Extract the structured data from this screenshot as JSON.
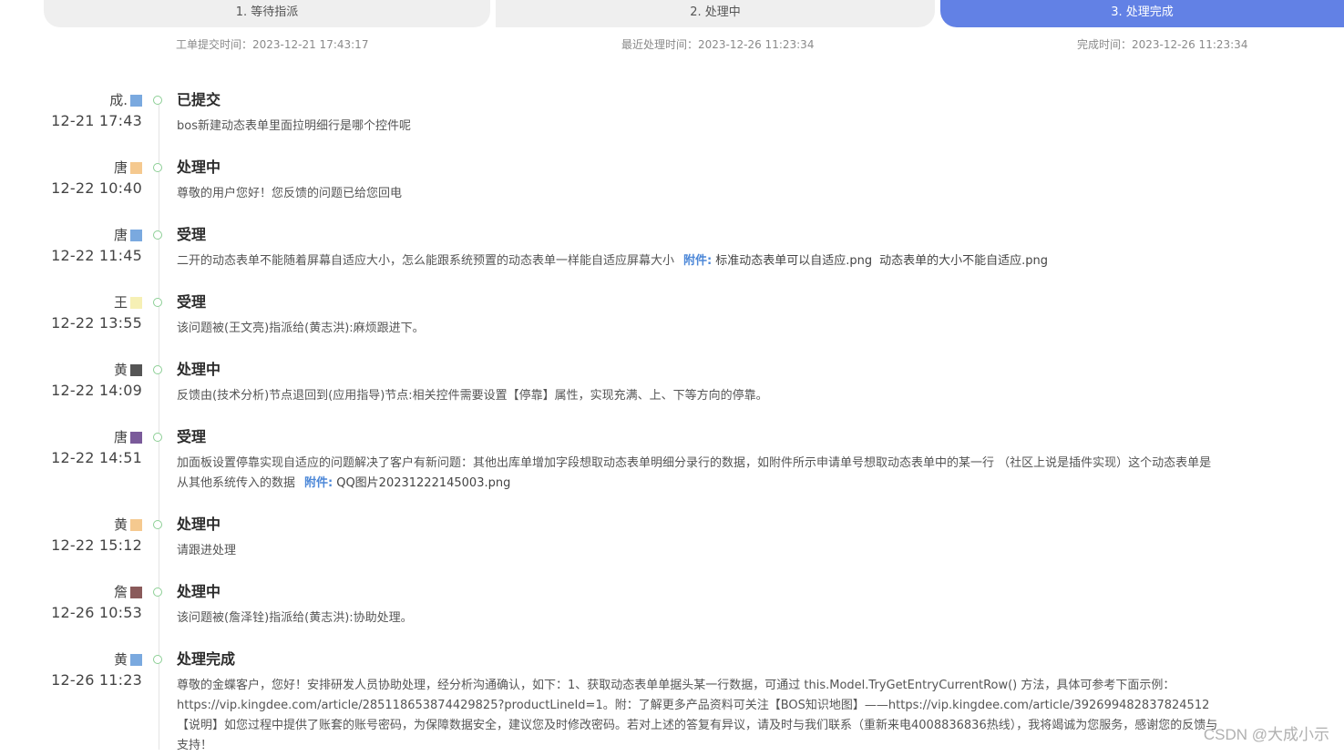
{
  "steps": [
    {
      "label": "1. 等待指派"
    },
    {
      "label": "2. 处理中"
    },
    {
      "label": "3. 处理完成"
    }
  ],
  "step_times": {
    "submitted": "工单提交时间：2023-12-21 17:43:17",
    "recent": "最近处理时间：2023-12-26 11:23:34",
    "done": "完成时间：2023-12-26 11:23:34"
  },
  "entries": [
    {
      "who": "成.",
      "time": "12-21 17:43",
      "status": "已提交",
      "content": "bos新建动态表单里面拉明细行是哪个控件呢",
      "avatar": "#7aa9df"
    },
    {
      "who": "唐",
      "time": "12-22 10:40",
      "status": "处理中",
      "content": "尊敬的用户您好！您反馈的问题已给您回电",
      "avatar": "#f5c98f"
    },
    {
      "who": "唐",
      "time": "12-22 11:45",
      "status": "受理",
      "content": "二开的动态表单不能随着屏幕自适应大小，怎么能跟系统预置的动态表单一样能自适应屏幕大小",
      "attach_label": "附件:",
      "files": [
        "标准动态表单可以自适应.png",
        "动态表单的大小不能自适应.png"
      ],
      "avatar": "#7aa9df"
    },
    {
      "who": "王",
      "time": "12-22 13:55",
      "status": "受理",
      "content": "该问题被(王文亮)指派给(黄志洪):麻烦跟进下。",
      "avatar": "#f6f0b5"
    },
    {
      "who": "黄",
      "time": "12-22 14:09",
      "status": "处理中",
      "content": "反馈由(技术分析)节点退回到(应用指导)节点:相关控件需要设置【停靠】属性，实现充满、上、下等方向的停靠。",
      "avatar": "#555555"
    },
    {
      "who": "唐",
      "time": "12-22 14:51",
      "status": "受理",
      "content": "加面板设置停靠实现自适应的问题解决了客户有新问题：其他出库单增加字段想取动态表单明细分录行的数据，如附件所示申请单号想取动态表单中的某一行 （社区上说是插件实现）这个动态表单是从其他系统传入的数据",
      "attach_label": "附件:",
      "files": [
        "QQ图片20231222145003.png"
      ],
      "avatar": "#7a5a9a"
    },
    {
      "who": "黄",
      "time": "12-22 15:12",
      "status": "处理中",
      "content": "请跟进处理",
      "avatar": "#f5c98f"
    },
    {
      "who": "詹",
      "time": "12-26 10:53",
      "status": "处理中",
      "content": "该问题被(詹泽铨)指派给(黄志洪):协助处理。",
      "avatar": "#8a5a5a"
    },
    {
      "who": "黄",
      "time": "12-26 11:23",
      "status": "处理完成",
      "content": "尊敬的金蝶客户，您好！安排研发人员协助处理，经分析沟通确认，如下：1、获取动态表单单据头某一行数据，可通过 this.Model.TryGetEntryCurrentRow() 方法，具体可参考下面示例：https://vip.kingdee.com/article/285118653874429825?productLineId=1。附：了解更多产品资料可关注【BOS知识地图】——https://vip.kingdee.com/article/392699482837824512【说明】如您过程中提供了账套的账号密码，为保障数据安全，建议您及时修改密码。若对上述的答复有异议，请及时与我们联系（重新来电4008836836热线），我将竭诚为您服务，感谢您的反馈与支持！",
      "avatar": "#7aa9df"
    }
  ],
  "watermark": "CSDN @大成小示"
}
